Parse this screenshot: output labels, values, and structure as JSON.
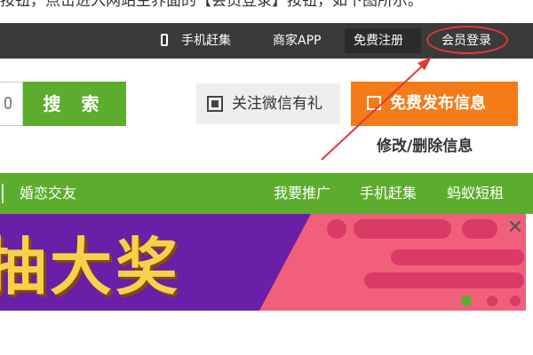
{
  "caption": {
    "text": "按钮，点击进入网站主界面的【会员登录】按钮，如下图所示。"
  },
  "topbar": {
    "mobile_label": "手机赶集",
    "merchant_app_label": "商家APP",
    "register_label": "免费注册",
    "login_label": "会员登录"
  },
  "search": {
    "button_label": "搜 索"
  },
  "actions": {
    "wechat_label": "关注微信有礼",
    "publish_label": "免费发布信息",
    "edit_label": "修改/删除信息"
  },
  "nav": {
    "left_item": "婚恋交友",
    "right_items": [
      "我要推广",
      "手机赶集",
      "蚂蚁短租"
    ]
  },
  "banner": {
    "text": "抽大奖"
  },
  "colors": {
    "topbar_bg": "#3a3a3a",
    "green": "#5cad2e",
    "orange": "#f47b17",
    "highlight_red": "#e23838",
    "banner_purple": "#6a1fa8",
    "banner_pink": "#f0607a"
  }
}
